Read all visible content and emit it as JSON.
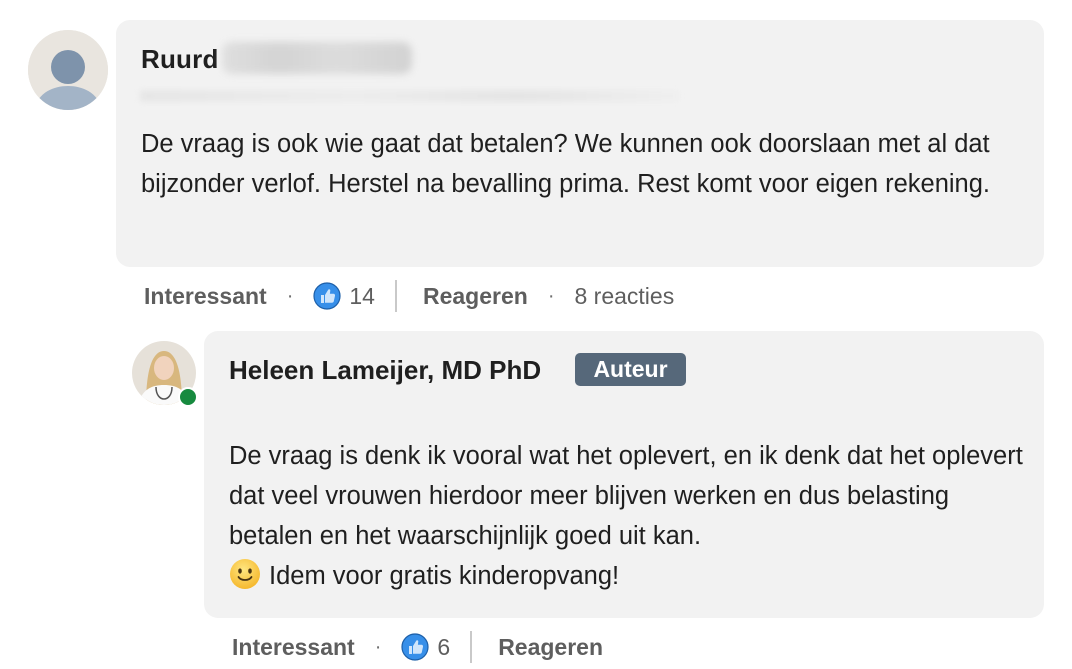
{
  "comments": [
    {
      "author": "Ruurd",
      "body": "De vraag is ook wie gaat dat betalen? We kunnen ook doorslaan met al dat bijzonder verlof. Herstel na bevalling prima. Rest komt voor eigen rekening.",
      "actions": {
        "like_label": "Interessant",
        "like_count": "14",
        "reply_label": "Reageren",
        "replies_count": "8 reacties"
      }
    },
    {
      "author": "Heleen Lameijer, MD PhD",
      "badge": "Auteur",
      "body_main": "De vraag is denk ik vooral wat het oplevert, en ik denk dat het oplevert dat veel vrouwen hierdoor meer blijven werken en dus belasting betalen en het waarschijnlijk goed uit kan.",
      "body_tail": "Idem voor gratis kinderopvang!",
      "actions": {
        "like_label": "Interessant",
        "like_count": "6",
        "reply_label": "Reageren"
      }
    }
  ],
  "icons": {
    "default_avatar": "person-silhouette-icon",
    "like": "thumbs-up-icon",
    "emoji": "slightly-smiling-face-icon",
    "online_status": "online-status-icon"
  },
  "colors": {
    "bubble": "#f2f2f2",
    "badge": "#56687a",
    "like_blue": "#378fe9",
    "online_green": "#178a3f"
  }
}
